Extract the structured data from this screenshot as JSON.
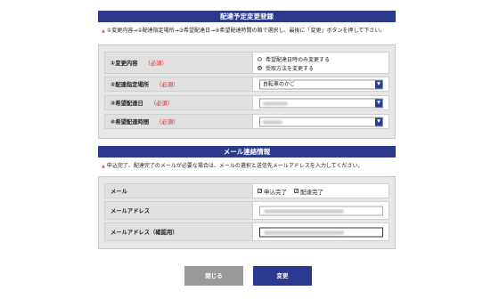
{
  "delivery": {
    "title": "配達予定変更登録",
    "instruction": "①変更内容→②配達指定場所→③希望配達日→④希望配達時間の順で選択し、最後に「変更」ボタンを押して下さい。",
    "rows": [
      {
        "label": "①変更内容",
        "required": "（必須）"
      },
      {
        "label": "②配達指定場所",
        "required": "（必須）"
      },
      {
        "label": "③希望配達日",
        "required": "（必須）"
      },
      {
        "label": "④希望配達時間",
        "required": "（必須）"
      }
    ],
    "radio_options": [
      "希望配達日時のみ変更する",
      "受取方法を変更する"
    ],
    "radio_selected": "受取方法を変更する",
    "place_value": "自転車のかご"
  },
  "mail": {
    "title": "メール連絡情報",
    "instruction": "申込完了、配達完了のメールが必要な場合は、メールの選択と送信先メールアドレスを入力してください。",
    "rows": [
      {
        "label": "メール"
      },
      {
        "label": "メールアドレス"
      },
      {
        "label": "メールアドレス（確認用）"
      }
    ],
    "checkboxes": [
      {
        "label": "申込完了",
        "checked": true
      },
      {
        "label": "配達完了",
        "checked": true
      }
    ]
  },
  "buttons": {
    "close": "閉じる",
    "change": "変更"
  },
  "colors": {
    "header": "#2d3a8c",
    "required": "#dd2222",
    "change_button": "#2b3990",
    "close_button": "#9a9a9a"
  }
}
